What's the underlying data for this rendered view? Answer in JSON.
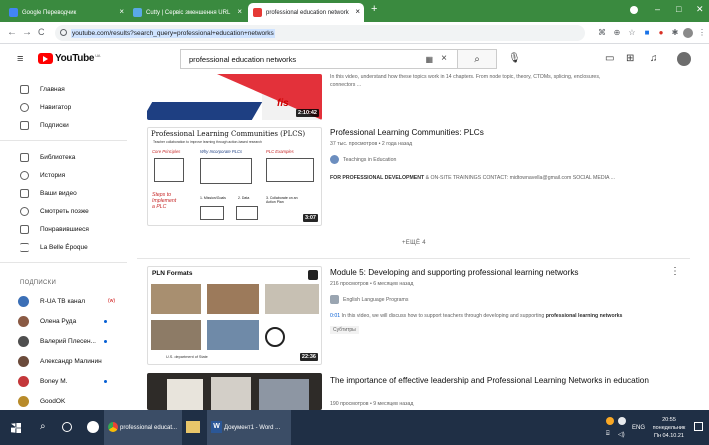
{
  "browser": {
    "tabs": [
      {
        "title": "Google Переводчик",
        "color": "#4285f4",
        "active": false
      },
      {
        "title": "Cutty | Сервіс зменшення URL",
        "color": "#5aa9e6",
        "active": false
      },
      {
        "title": "professional education network",
        "color": "#e53935",
        "active": true
      }
    ],
    "new_tab": "+",
    "url": "youtube.com/results?search_query=professional+education+networks",
    "back": "←",
    "forward": "→",
    "reload": "C"
  },
  "youtube": {
    "logo_text": "YouTube",
    "logo_sup": "UA",
    "search_value": "professional education networks",
    "search_icon": "search-icon"
  },
  "sidebar": {
    "items": [
      {
        "label": "Главная"
      },
      {
        "label": "Навигатор"
      },
      {
        "label": "Подписки"
      },
      {
        "label": "Библиотека"
      },
      {
        "label": "История"
      },
      {
        "label": "Ваши видео"
      },
      {
        "label": "Смотреть позже"
      },
      {
        "label": "Понравившиеся"
      },
      {
        "label": "La Belle Époque"
      }
    ],
    "subs_header": "ПОДПИСКИ",
    "subs": [
      {
        "label": "R-UA ТВ канал",
        "color": "#3b6fb6",
        "badge": "(w)"
      },
      {
        "label": "Олена Руда",
        "color": "#8a5a44"
      },
      {
        "label": "Валерий Плесен...",
        "color": "#4f4f4f"
      },
      {
        "label": "Александр Малинин",
        "color": "#6b4b3b"
      },
      {
        "label": "Boney M.",
        "color": "#c4373a"
      },
      {
        "label": "GoodOK",
        "color": "#b88b2a"
      }
    ]
  },
  "results": {
    "top_partial_desc": "In this video, understand how these topics work in 14 chapters. From node topic, theory, CTDMs, splicing, enclosures,",
    "top_partial_desc2": "connectors ...",
    "top_duration": "2:10:42",
    "v1": {
      "title": "Professional Learning Communities: PLCs",
      "meta": "37 тыс. просмотров • 2 года назад",
      "channel": "Teachings in Education",
      "desc_bold": "FOR PROFESSIONAL DEVELOPMENT",
      "desc_rest": " & ON-SITE TRAININGS CONTACT: midtownavella@gmail.com SOCIAL MEDIA ...",
      "duration": "3:07",
      "thumb_title": "Professional Learning Communities (PLCS)",
      "thumb_sub": "Teacher collaboration to improve learning through action-based research",
      "thumb_labels": [
        "Core Principles",
        "Why Incorporate PLCs",
        "PLC Examples",
        "Steps to Implement a PLC",
        "1. Mission/Goals",
        "2. Data",
        "3. Collaborate on an Action Plan"
      ]
    },
    "more": "+ЕЩЁ 4",
    "v2": {
      "title": "Module 5: Developing and supporting professional learning networks",
      "meta": "216 просмотров • 6 месяцев назад",
      "channel": "English Language Programs",
      "ts": "0:01",
      "desc": " In this video, we will discuss how to support teachers through developing and supporting ",
      "desc_bold": "professional learning networks",
      "tag": "Субтитры",
      "duration": "22:36",
      "thumb_header": "PLN Formats",
      "thumb_footer": "U.S. department of State"
    },
    "v3": {
      "title": "The importance of effective leadership and Professional Learning Networks in education",
      "meta": "190 просмотров • 9 месяцев назад"
    }
  },
  "taskbar": {
    "chrome_label": "professional educat...",
    "word_label": "Документ1 - Word ...",
    "lang": "ENG",
    "time": "20:55",
    "day": "понедельник",
    "date": "Пн 04.10.21"
  }
}
